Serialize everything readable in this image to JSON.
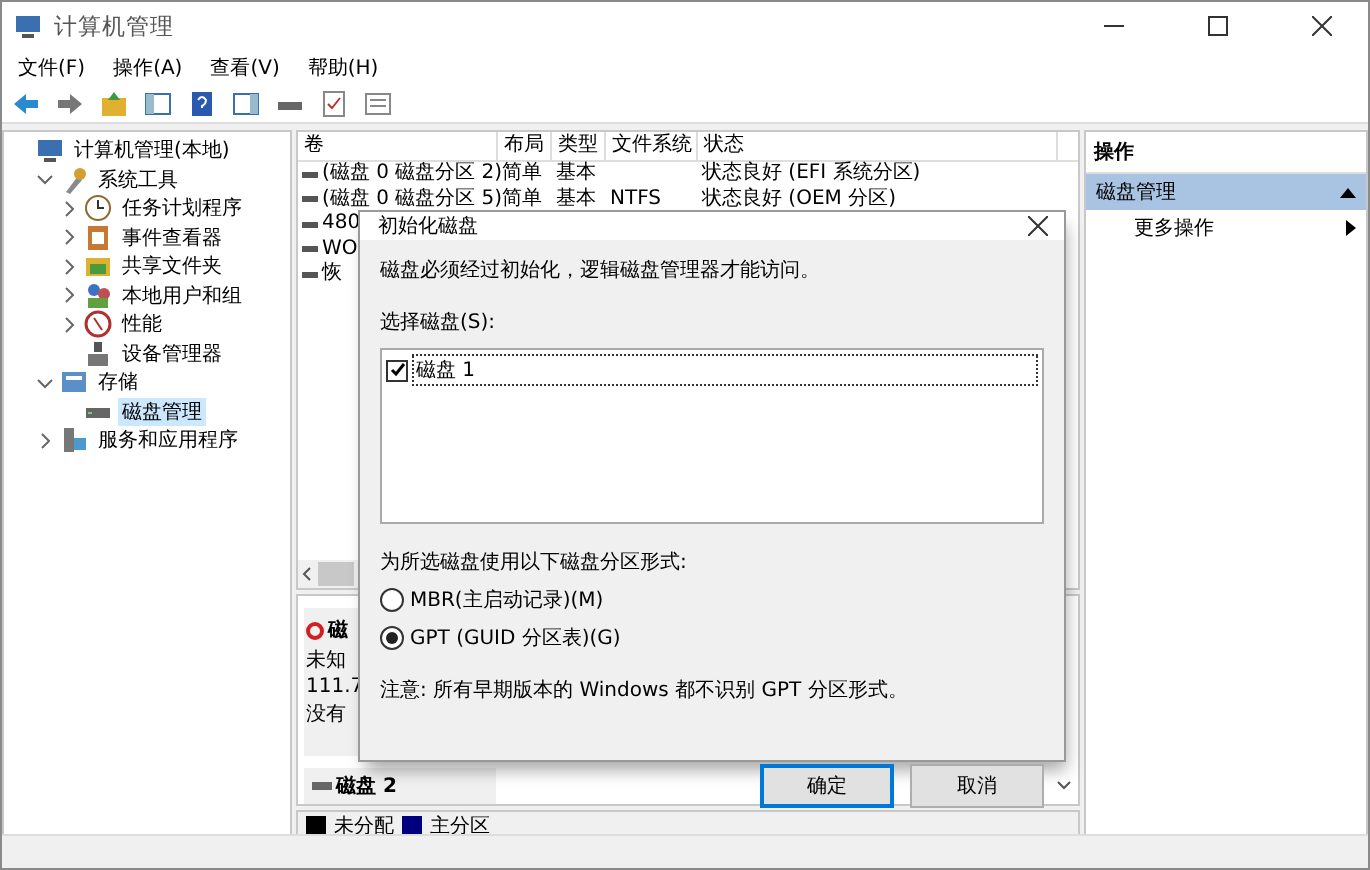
{
  "window": {
    "title": "计算机管理"
  },
  "menu": [
    "文件(F)",
    "操作(A)",
    "查看(V)",
    "帮助(H)"
  ],
  "tree": [
    {
      "label": "计算机管理(本地)",
      "selected": false,
      "children": [
        {
          "label": "系统工具",
          "expanded": true,
          "selected": false,
          "children": [
            {
              "label": "任务计划程序",
              "expanded": false,
              "selected": false
            },
            {
              "label": "事件查看器",
              "expanded": false,
              "selected": false
            },
            {
              "label": "共享文件夹",
              "expanded": false,
              "selected": false
            },
            {
              "label": "本地用户和组",
              "expanded": false,
              "selected": false
            },
            {
              "label": "性能",
              "expanded": false,
              "selected": false
            },
            {
              "label": "设备管理器",
              "selected": false
            }
          ]
        },
        {
          "label": "存储",
          "expanded": true,
          "selected": false,
          "children": [
            {
              "label": "磁盘管理",
              "selected": true
            }
          ]
        },
        {
          "label": "服务和应用程序",
          "expanded": false,
          "selected": false
        }
      ]
    }
  ],
  "volumes": {
    "columns": [
      "卷",
      "布局",
      "类型",
      "文件系统",
      "状态"
    ],
    "rows": [
      {
        "volume": "(磁盘 0 磁盘分区 2)",
        "layout": "简单",
        "type": "基本",
        "status": "状态良好 (EFI 系统分区)"
      },
      {
        "volume": "(磁盘 0 磁盘分区 5)",
        "layout": "简单",
        "type": "基本",
        "filesystem": "NTFS",
        "status": "状态良好 (OEM 分区)"
      },
      {
        "volume": "480"
      },
      {
        "volume": "WO"
      },
      {
        "volume": "恢"
      }
    ]
  },
  "disks": [
    {
      "kind": "uninitialized",
      "name": "磁",
      "lines": [
        "未知",
        "111.7",
        "没有"
      ]
    },
    {
      "kind": "basic",
      "name": "磁盘 2"
    }
  ],
  "legend": [
    {
      "label": "未分配",
      "color": "#000000"
    },
    {
      "label": "主分区",
      "color": "#00007f"
    }
  ],
  "actions": {
    "title": "操作",
    "items": [
      {
        "label": "磁盘管理",
        "kind": "section",
        "selected": true
      },
      {
        "label": "更多操作",
        "kind": "submenu",
        "selected": false
      }
    ]
  },
  "dialog": {
    "title": "初始化磁盘",
    "message": "磁盘必须经过初始化，逻辑磁盘管理器才能访问。",
    "select_label": "选择磁盘(S):",
    "disks": [
      {
        "label": "磁盘 1",
        "checked": true
      }
    ],
    "style_label": "为所选磁盘使用以下磁盘分区形式:",
    "options": [
      {
        "label": "MBR(主启动记录)(M)",
        "selected": false
      },
      {
        "label": "GPT (GUID 分区表)(G)",
        "selected": true
      }
    ],
    "note": "注意: 所有早期版本的 Windows 都不识别 GPT 分区形式。",
    "buttons": [
      {
        "label": "确定",
        "default": true
      },
      {
        "label": "取消",
        "default": false
      }
    ]
  }
}
